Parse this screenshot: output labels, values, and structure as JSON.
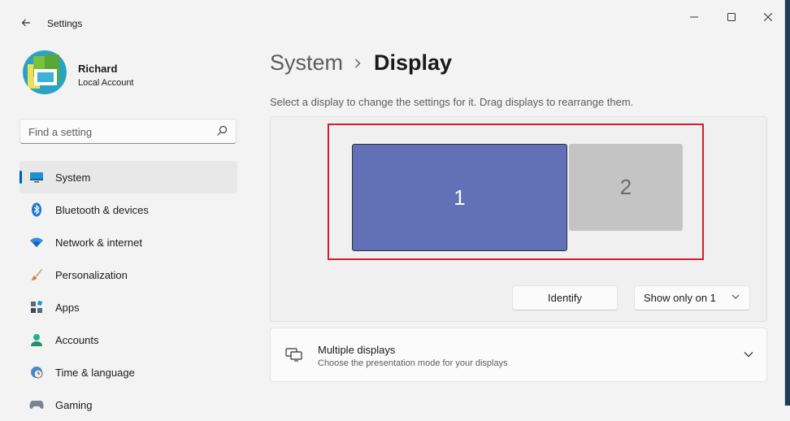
{
  "window": {
    "title": "Settings"
  },
  "user": {
    "name": "Richard",
    "account_type": "Local Account"
  },
  "search": {
    "placeholder": "Find a setting"
  },
  "nav": {
    "items": [
      {
        "label": "System",
        "icon": "system-icon",
        "active": true
      },
      {
        "label": "Bluetooth & devices",
        "icon": "bluetooth-icon"
      },
      {
        "label": "Network & internet",
        "icon": "network-icon"
      },
      {
        "label": "Personalization",
        "icon": "brush-icon"
      },
      {
        "label": "Apps",
        "icon": "apps-icon"
      },
      {
        "label": "Accounts",
        "icon": "accounts-icon"
      },
      {
        "label": "Time & language",
        "icon": "globe-clock-icon"
      },
      {
        "label": "Gaming",
        "icon": "gaming-icon"
      }
    ]
  },
  "breadcrumb": {
    "parent": "System",
    "current": "Display"
  },
  "display": {
    "hint": "Select a display to change the settings for it. Drag displays to rearrange them.",
    "monitors": [
      {
        "label": "1",
        "selected": true,
        "color": "#6271b7"
      },
      {
        "label": "2",
        "selected": false,
        "color": "#c4c4c4"
      }
    ],
    "identify_label": "Identify",
    "show_mode_value": "Show only on 1"
  },
  "multiple_displays": {
    "title": "Multiple displays",
    "subtitle": "Choose the presentation mode for your displays"
  },
  "colors": {
    "accent": "#005fb8",
    "highlight_box": "#d0202c"
  }
}
